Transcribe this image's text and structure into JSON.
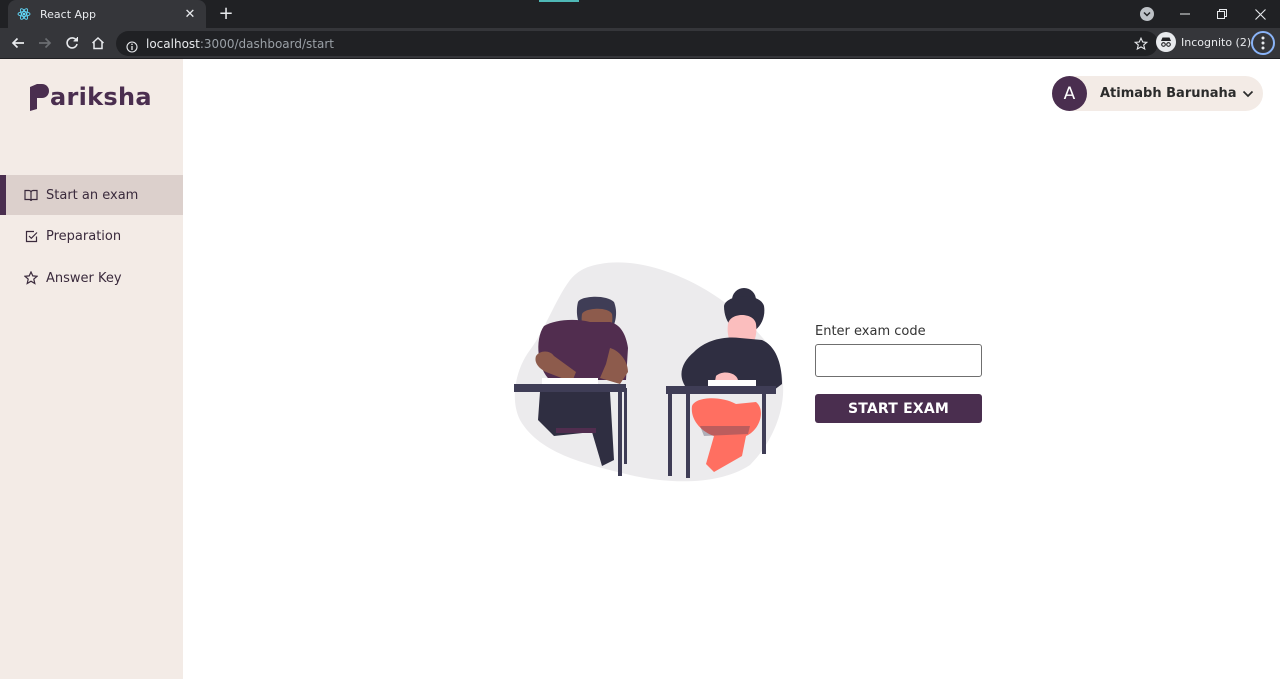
{
  "browser": {
    "tab_title": "React App",
    "tab_close": "✕",
    "new_tab": "+",
    "url_host": "localhost",
    "url_rest": ":3000/dashboard/start",
    "incognito_label": "Incognito (2)"
  },
  "app": {
    "logo_text": "ariksha",
    "nav": [
      {
        "label": "Start an exam",
        "icon": "book-icon"
      },
      {
        "label": "Preparation",
        "icon": "checkbox-icon"
      },
      {
        "label": "Answer Key",
        "icon": "star-icon"
      }
    ],
    "user": {
      "initial": "A",
      "name": "Atimabh Barunaha"
    },
    "exam": {
      "label": "Enter exam code",
      "input_value": "",
      "button": "START EXAM"
    }
  },
  "colors": {
    "brand": "#4a2e4f",
    "sidebar_bg": "#f3ebe6",
    "active_bg": "#dcd0cc"
  }
}
